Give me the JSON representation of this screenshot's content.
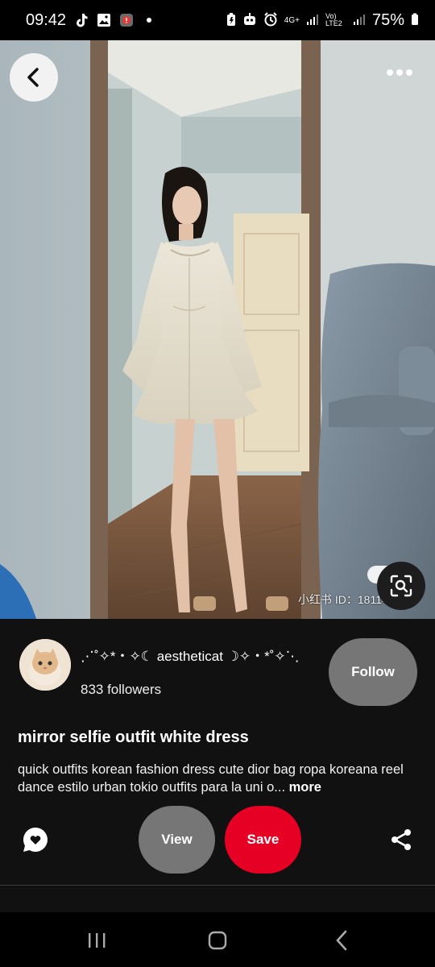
{
  "status_bar": {
    "time": "09:42",
    "battery": "75%",
    "network_4g": "4G+",
    "network_volte": "Vo) LTE2",
    "left_icons": [
      "tiktok-icon",
      "gallery-icon",
      "notification-badge-icon",
      "dot-icon"
    ],
    "right_icons": [
      "battery-saver-icon",
      "robot-icon",
      "alarm-icon",
      "signal-icon",
      "battery-icon"
    ]
  },
  "photo": {
    "watermark": "小红书 ID：181140443",
    "description_icons": [
      "back-arrow-icon",
      "more-options-icon",
      "visual-search-icon"
    ]
  },
  "pin": {
    "username": "⋰˚✧*・✧☾ aestheticat ☽✧・*˚✧⋱",
    "followers": "833 followers",
    "follow_label": "Follow",
    "title": "mirror selfie outfit white dress",
    "description": "quick outfits korean fashion dress cute dior bag ropa koreana reel dance estilo urban tokio outfits para la uni o...",
    "more_label": "more",
    "view_label": "View",
    "save_label": "Save"
  },
  "colors": {
    "save": "#e60023",
    "secondary_button": "#767676",
    "panel": "#111111"
  }
}
